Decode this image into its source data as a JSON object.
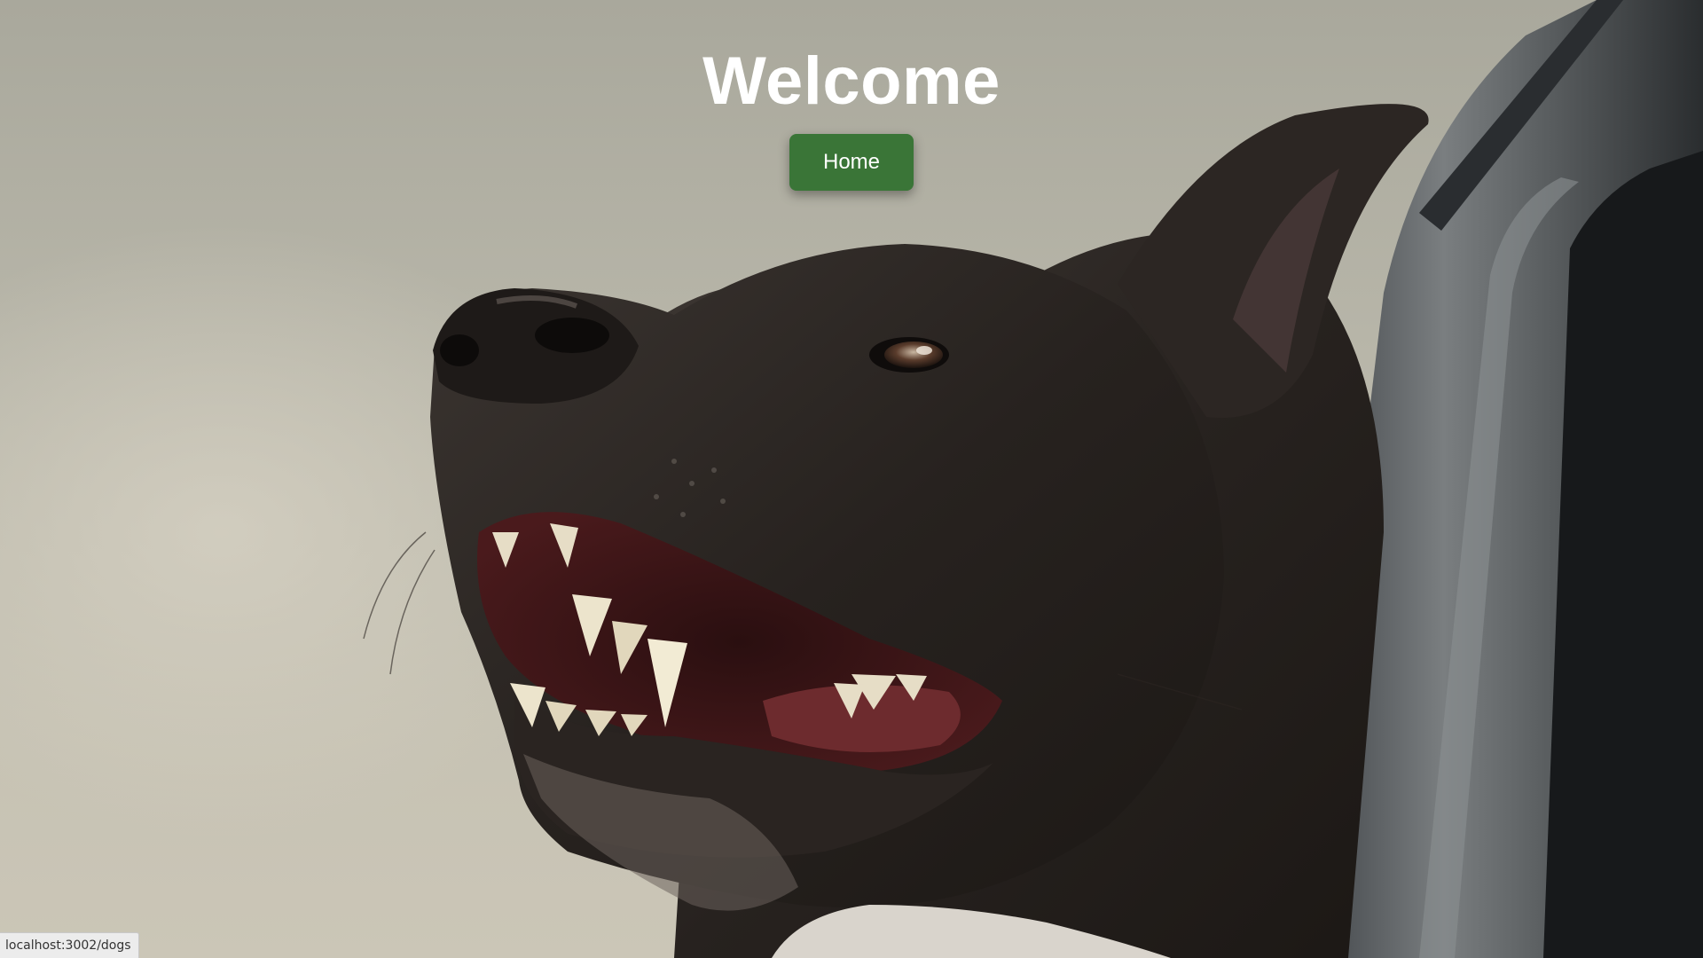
{
  "page": {
    "title": "Welcome",
    "home_button_label": "Home"
  },
  "background_image": {
    "subject": "black dog with head out of car window, mouth open"
  },
  "status_bar": {
    "url": "localhost:3002/dogs"
  },
  "colors": {
    "button_green": "#3a7537",
    "title_text": "#ffffff"
  }
}
